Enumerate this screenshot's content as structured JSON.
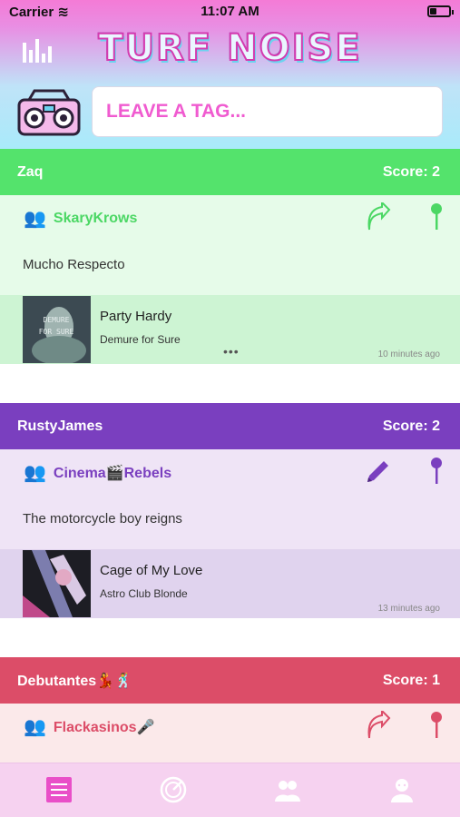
{
  "status_bar": {
    "carrier": "Carrier",
    "time": "11:07 AM"
  },
  "header": {
    "logo_text": "TURF NOISE",
    "tag_placeholder": "LEAVE A TAG..."
  },
  "feed": [
    {
      "crew": "Zaq",
      "score_label": "Score: 2",
      "user": "SkaryKrows",
      "action_icon": "upvote-arrow-icon",
      "message": "Mucho Respecto",
      "track": {
        "title": "Party Hardy",
        "artist": "Demure for Sure",
        "time": "10 minutes ago",
        "art_text": "DEMURE FOR SURE"
      },
      "colors": {
        "header": "#54e36c",
        "user_bg": "#e6fbe9",
        "track_bg": "#cdf4d3",
        "accent": "#4bd764"
      }
    },
    {
      "crew": "RustyJames",
      "score_label": "Score: 2",
      "user": "Cinema🎬Rebels",
      "action_icon": "pencil-icon",
      "message": "The motorcycle boy reigns",
      "track": {
        "title": "Cage of My Love",
        "artist": "Astro Club Blonde",
        "time": "13 minutes ago",
        "art_text": ""
      },
      "colors": {
        "header": "#7a3fbf",
        "user_bg": "#efe4f6",
        "track_bg": "#e0d3ee",
        "accent": "#7a3fbf"
      }
    },
    {
      "crew": "Debutantes💃🕺",
      "score_label": "Score: 1",
      "user": "Flackasinos🎤",
      "action_icon": "upvote-arrow-icon",
      "message": "",
      "track": null,
      "colors": {
        "header": "#dc4d68",
        "user_bg": "#fbe9ea",
        "track_bg": "#f5d8dc",
        "accent": "#dc4d68"
      }
    }
  ],
  "tabbar": {
    "items": [
      "feed-tab",
      "radar-tab",
      "crews-tab",
      "profile-tab"
    ],
    "active": "feed-tab",
    "active_color": "#e94fc8"
  }
}
